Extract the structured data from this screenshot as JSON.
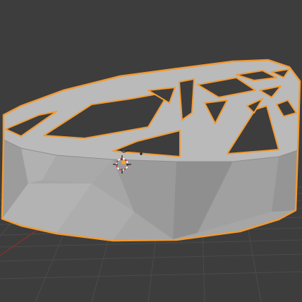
{
  "viewport": {
    "mode": "3D Viewport",
    "object": "mesh-object",
    "selected": true,
    "colors": {
      "background": "#3d3d3d",
      "grid_line": "#4a4a4a",
      "x_axis": "#8a3a3a",
      "mesh_top": "#b9b9b9",
      "mesh_side": "#a3a3a3",
      "selection_outline": "#f29a32",
      "origin_dot": "#f5a623",
      "cursor_red": "#d23a3a"
    }
  }
}
